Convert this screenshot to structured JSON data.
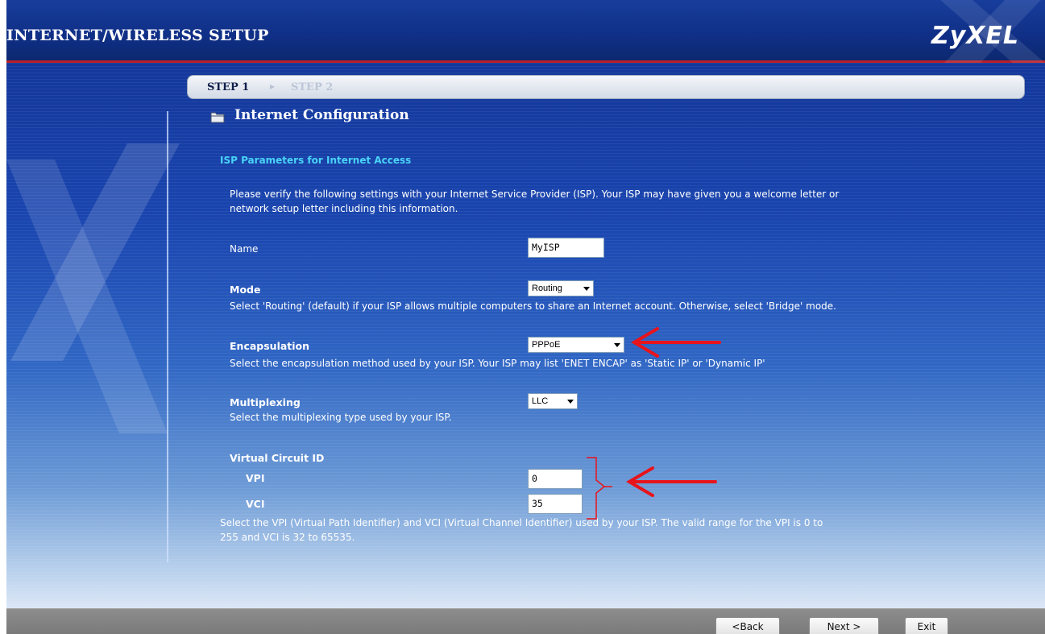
{
  "header": {
    "title": "INTERNET/WIRELESS SETUP",
    "logo": "ZyXEL"
  },
  "steps": {
    "current": "STEP 1",
    "separator_icon": "chevron-right-icon",
    "next": "STEP 2"
  },
  "section": {
    "icon": "folder-icon",
    "title": "Internet Configuration"
  },
  "isp": {
    "heading": "ISP Parameters for Internet Access",
    "intro_line1": "Please verify the following settings with your Internet Service Provider (ISP). Your ISP may have given you a welcome letter or",
    "intro_line2": "network setup letter including this information."
  },
  "fields": {
    "name": {
      "label": "Name",
      "value": "MyISP"
    },
    "mode": {
      "label": "Mode",
      "selected": "Routing",
      "help": "Select 'Routing' (default) if your ISP allows multiple computers to share an Internet account. Otherwise, select 'Bridge' mode."
    },
    "encapsulation": {
      "label": "Encapsulation",
      "selected": "PPPoE",
      "help": "Select the encapsulation method used by your ISP. Your ISP may list 'ENET ENCAP' as 'Static IP' or 'Dynamic IP'"
    },
    "multiplexing": {
      "label": "Multiplexing",
      "selected": "LLC",
      "help": "Select the multiplexing type used by your ISP."
    },
    "vc": {
      "label": "Virtual Circuit ID",
      "vpi_label": "VPI",
      "vpi_value": "0",
      "vci_label": "VCI",
      "vci_value": "35",
      "help_line1": "Select the VPI (Virtual Path Identifier) and VCI (Virtual Channel Identifier) used by your ISP. The valid range for the VPI is 0 to",
      "help_line2": "255 and VCI is 32 to 65535."
    }
  },
  "footer": {
    "back": "<Back",
    "next": "Next >",
    "exit": "Exit"
  },
  "colors": {
    "header_bg": "#102f86",
    "accent_red": "#bb1f2a",
    "heading_cyan": "#49d3f8",
    "annotation_red": "#e8141c"
  }
}
